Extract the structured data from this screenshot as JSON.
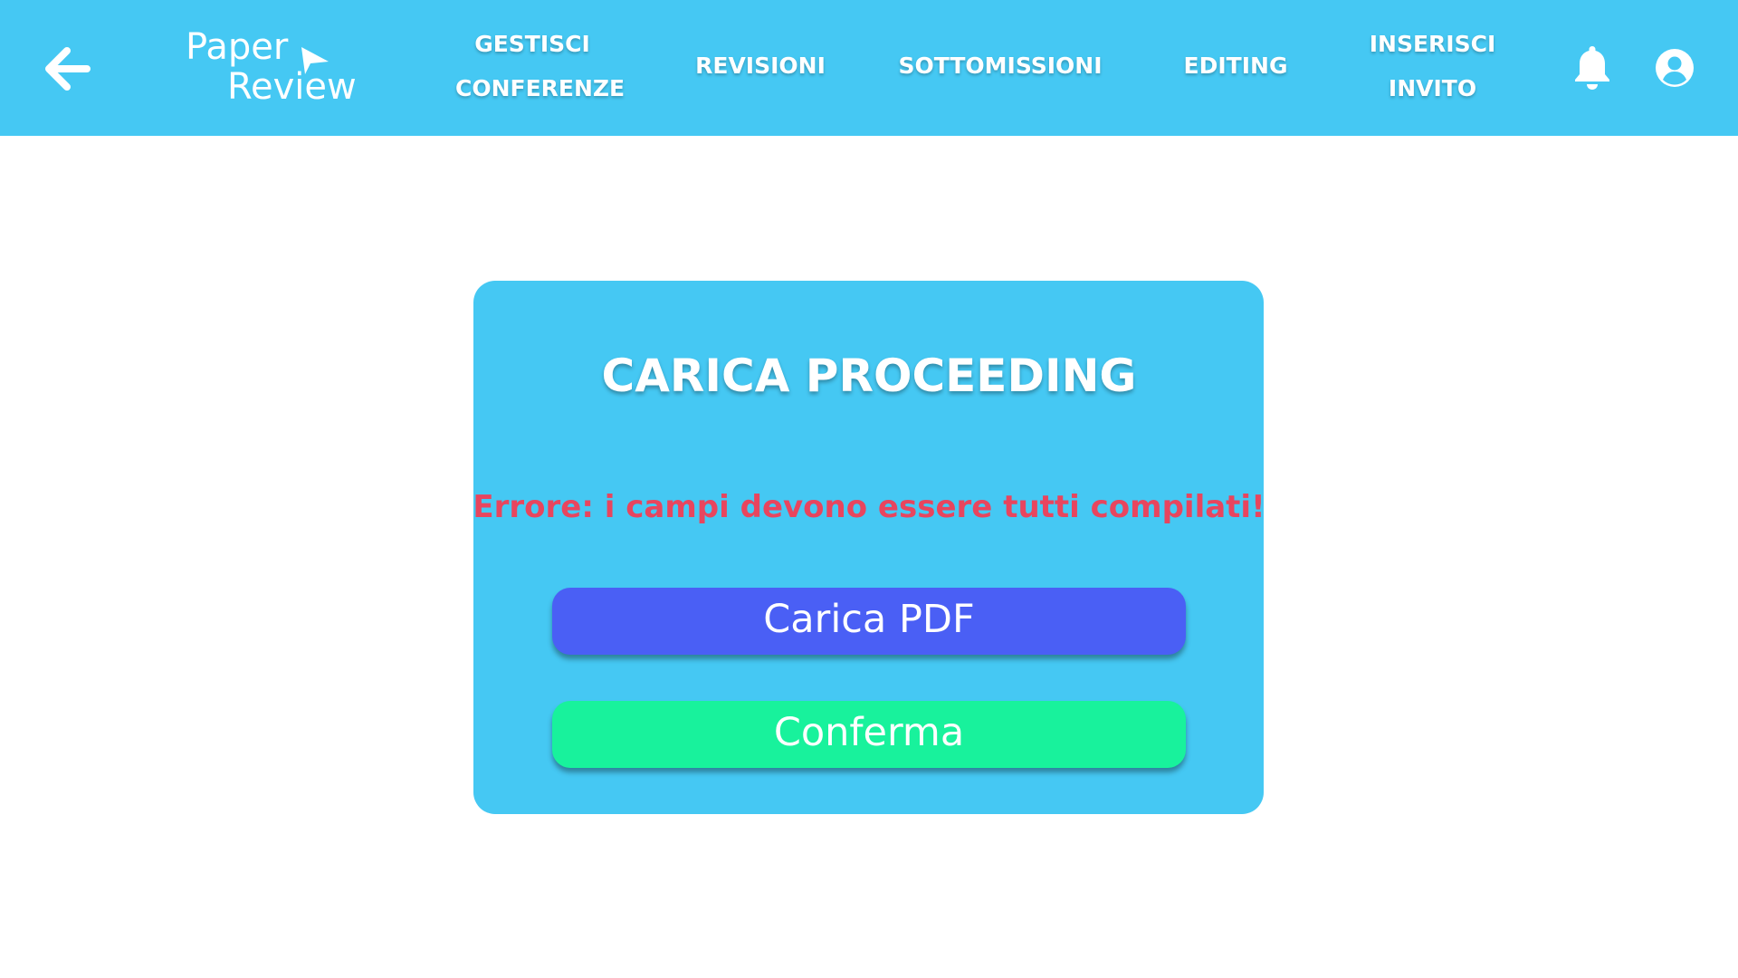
{
  "header": {
    "logo_line1": "Paper",
    "logo_line2": "Review",
    "nav": [
      {
        "line1": "GESTISCI",
        "line2": "CONFERENZE"
      },
      {
        "line1": "REVISIONI"
      },
      {
        "line1": "SOTTOMISSIONI"
      },
      {
        "line1": "EDITING"
      },
      {
        "line1": "INSERISCI",
        "line2": "INVITO"
      }
    ],
    "icons": {
      "back": "arrow-left-icon",
      "notifications": "bell-icon",
      "profile": "user-circle-icon"
    }
  },
  "card": {
    "title": "CARICA PROCEEDING",
    "error": "Errore: i campi devono essere tutti compilati!",
    "upload_label": "Carica PDF",
    "confirm_label": "Conferma"
  },
  "colors": {
    "primary": "#45c8f3",
    "error": "#e8455e",
    "upload_button": "#4a5ff5",
    "confirm_button": "#18f29c"
  }
}
